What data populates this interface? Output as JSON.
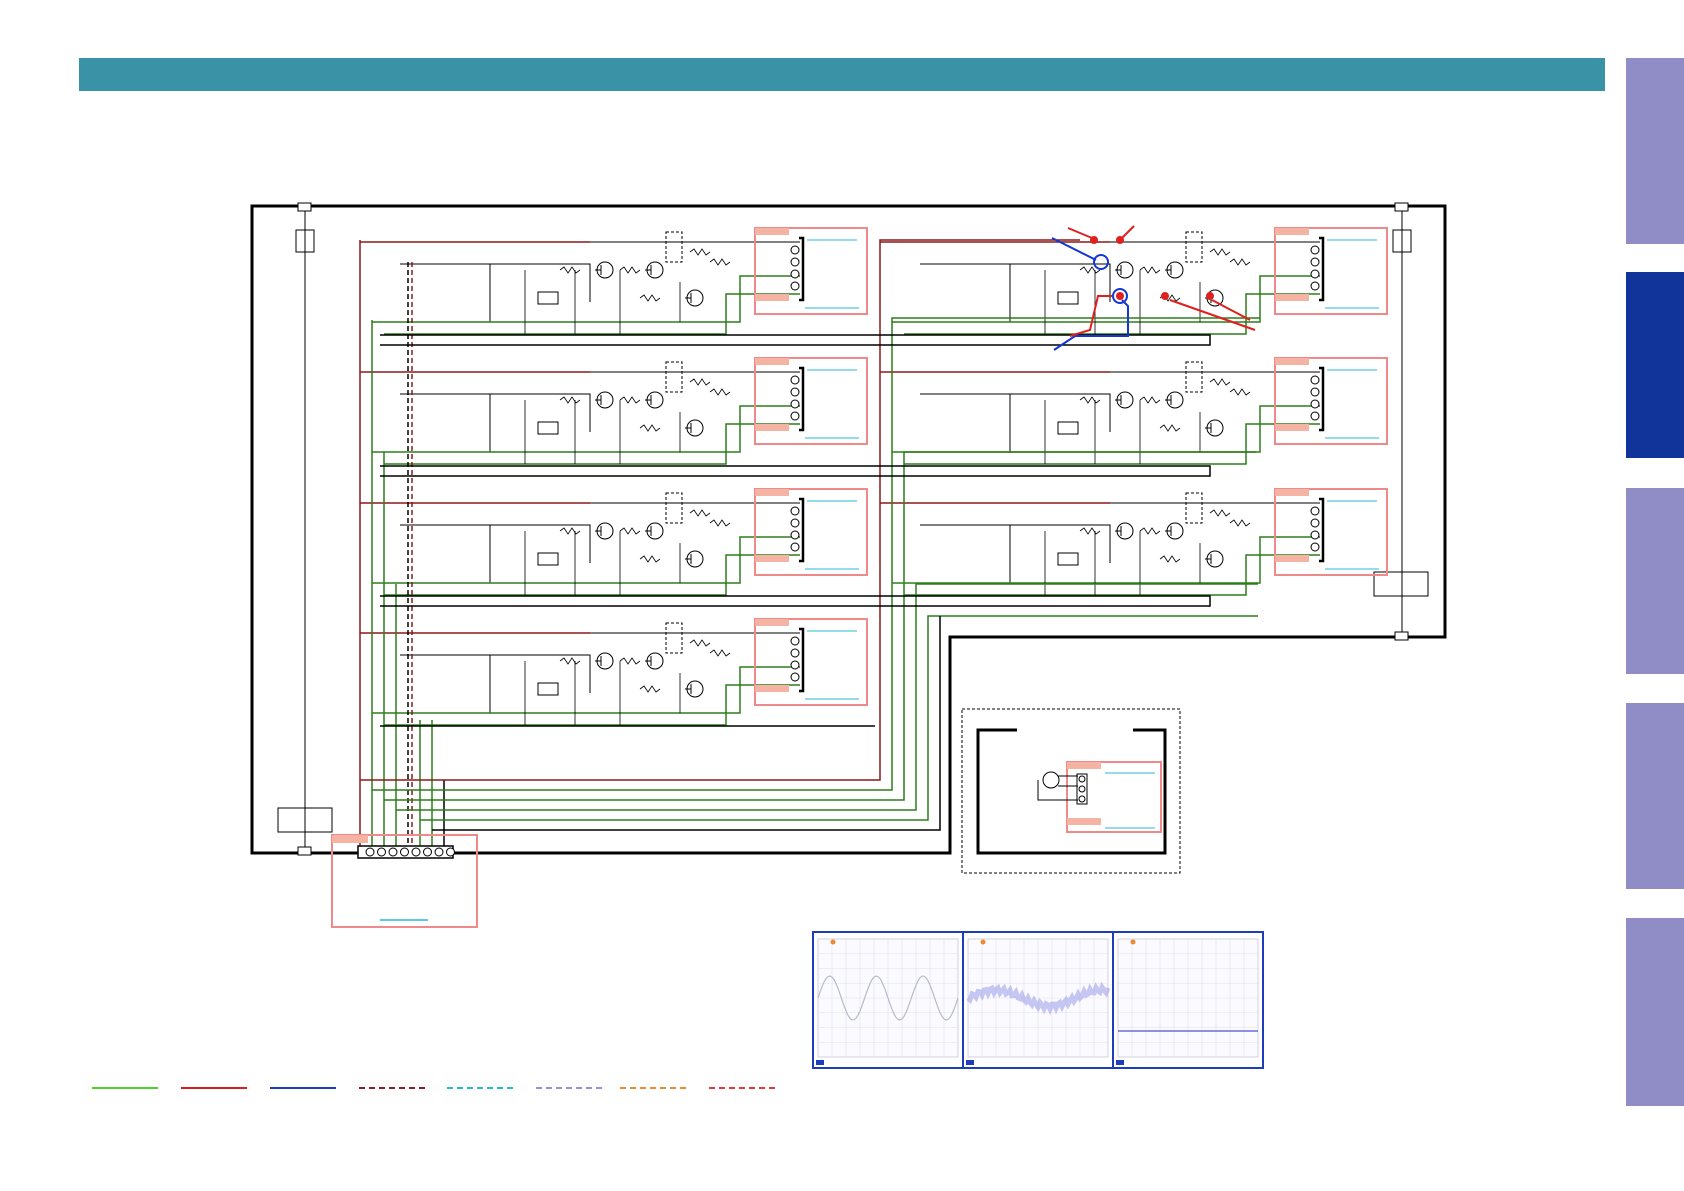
{
  "colors": {
    "header": "#3a92a6",
    "side_tab": "#908cc6",
    "side_tab_active": "#10349a",
    "wire_power": "#8b1a1a",
    "wire_ground": "#2e7d1e",
    "connector_box": "#f08a8a",
    "connector_label": "#f5b3a3",
    "highlight_red": "#e0201e",
    "highlight_blue": "#1436d6",
    "scope_frame": "#1d3dbd",
    "legend": [
      "#4cd42c",
      "#d62020",
      "#1a3ec0",
      "#8b1a2a",
      "#29b8d8",
      "#9a8fd8",
      "#f08a32",
      "#e03a3a"
    ]
  },
  "side_tabs": [
    {
      "name": "tab-1",
      "active": false
    },
    {
      "name": "tab-2",
      "active": true
    },
    {
      "name": "tab-3",
      "active": false
    },
    {
      "name": "tab-4",
      "active": false
    },
    {
      "name": "tab-5",
      "active": false
    }
  ],
  "legend_styles": [
    "solid",
    "solid",
    "solid",
    "dashed",
    "dashed",
    "dashed",
    "dashed",
    "dashed"
  ]
}
